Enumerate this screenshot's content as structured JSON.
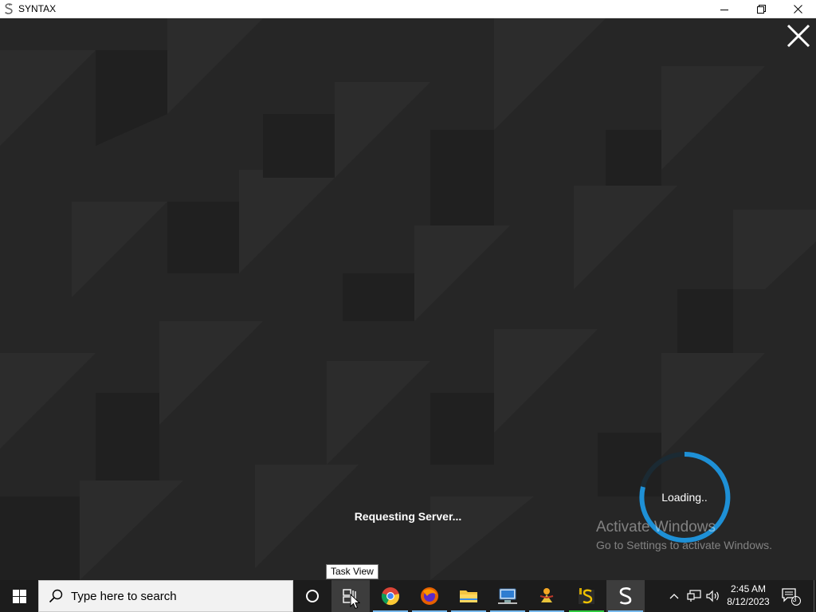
{
  "window": {
    "title": "SYNTAX",
    "controls": [
      "minimize",
      "maximize",
      "close"
    ]
  },
  "app": {
    "status_text": "Requesting Server...",
    "loading_label": "Loading..",
    "background_color": "#262626",
    "spinner_color": "#1e90d6"
  },
  "watermark": {
    "title": "Activate Windows",
    "subtitle": "Go to Settings to activate Windows."
  },
  "tooltip": {
    "text": "Task View"
  },
  "taskbar": {
    "search_placeholder": "Type here to search",
    "pinned": [
      {
        "name": "cortana-icon"
      },
      {
        "name": "task-view-icon"
      },
      {
        "name": "chrome-icon"
      },
      {
        "name": "firefox-icon"
      },
      {
        "name": "file-explorer-icon"
      },
      {
        "name": "network-app-icon"
      },
      {
        "name": "game-app-icon"
      },
      {
        "name": "syntax-launcher-icon"
      },
      {
        "name": "syntax-app-icon"
      }
    ],
    "tray": {
      "time": "2:45 AM",
      "date": "8/12/2023",
      "notification_count": "3"
    }
  }
}
